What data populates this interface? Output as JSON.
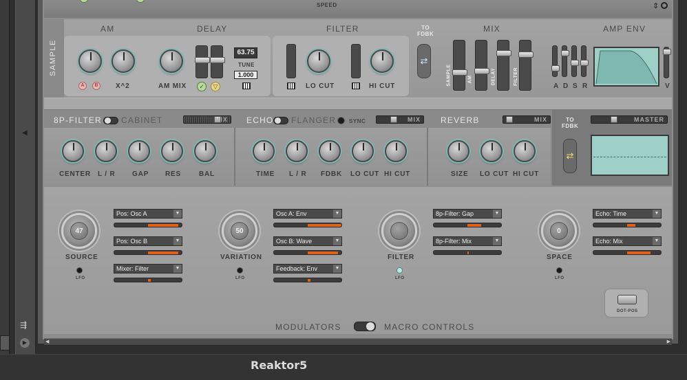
{
  "app": {
    "title": "Reaktor5"
  },
  "top": {
    "speed_label": "SPEED",
    "arrows": "⇕",
    "search_icon": "search-icon"
  },
  "synth": {
    "sample_label": "SAMPLE",
    "am": {
      "title": "AM",
      "btn_a": "A",
      "btn_b": "B",
      "x2": "X^2"
    },
    "delay": {
      "title": "DELAY",
      "am_mix": "AM MIX",
      "tune_value": "63.75",
      "tune_label": "TUNE",
      "value2": "1.000"
    },
    "filter": {
      "title": "FILTER",
      "lo_cut": "LO CUT",
      "hi_cut": "HI CUT"
    },
    "to_fdbk": "TO\nFDBK",
    "mix": {
      "title": "MIX",
      "faders": [
        "SAMPLE",
        "AM",
        "DELAY",
        "FILTER"
      ]
    },
    "amp_env": {
      "title": "AMP ENV",
      "adsr": [
        "A",
        "D",
        "S",
        "R"
      ],
      "v": "V"
    }
  },
  "fx": {
    "filter_title": "8P-FILTER",
    "cabinet": "CABINET",
    "filter_mix": "MIX",
    "filter_knobs": [
      "CENTER",
      "L / R",
      "GAP",
      "RES",
      "BAL"
    ],
    "echo_title": "ECHO",
    "flanger": "FLANGER",
    "sync": "SYNC",
    "echo_mix": "MIX",
    "echo_knobs": [
      "TIME",
      "L / R",
      "FDBK",
      "LO CUT",
      "HI CUT"
    ],
    "reverb_title": "REVERB",
    "reverb_mix": "MIX",
    "reverb_knobs": [
      "SIZE",
      "LO CUT",
      "HI CUT"
    ],
    "to_fdbk": "TO\nFDBK",
    "master": "MASTER"
  },
  "macro": {
    "groups": [
      {
        "name": "SOURCE",
        "value": "47",
        "lfo": "LFO",
        "slots": [
          {
            "label": "Pos: Osc A",
            "fill": 0.45
          },
          {
            "label": "Pos: Osc B",
            "fill": 0.45
          },
          {
            "label": "Mixer: Filter",
            "fill": 0.05
          }
        ]
      },
      {
        "name": "VARIATION",
        "value": "50",
        "lfo": "LFO",
        "slots": [
          {
            "label": "Osc A: Env",
            "fill": 0.5
          },
          {
            "label": "Osc B: Wave",
            "fill": 0.45
          },
          {
            "label": "Feedback: Env",
            "fill": 0.05
          }
        ]
      },
      {
        "name": "FILTER",
        "value": "",
        "lfo": "LFO",
        "slots": [
          {
            "label": "8p-Filter: Gap",
            "fill": 0.2
          },
          {
            "label": "8p-Filter: Mix",
            "fill": 0.02
          }
        ]
      },
      {
        "name": "SPACE",
        "value": "0",
        "lfo": "LFO",
        "slots": [
          {
            "label": "Echo: Time",
            "fill": 0.12
          },
          {
            "label": "Echo: Mix",
            "fill": 0.35
          }
        ]
      }
    ],
    "dotpos": "DOT-POS",
    "modulators": "MODULATORS",
    "macro_controls": "MACRO CONTROLS"
  },
  "colors": {
    "accent": "#e0621a",
    "display": "#9fd0c8",
    "led": "#bfe8e0"
  }
}
